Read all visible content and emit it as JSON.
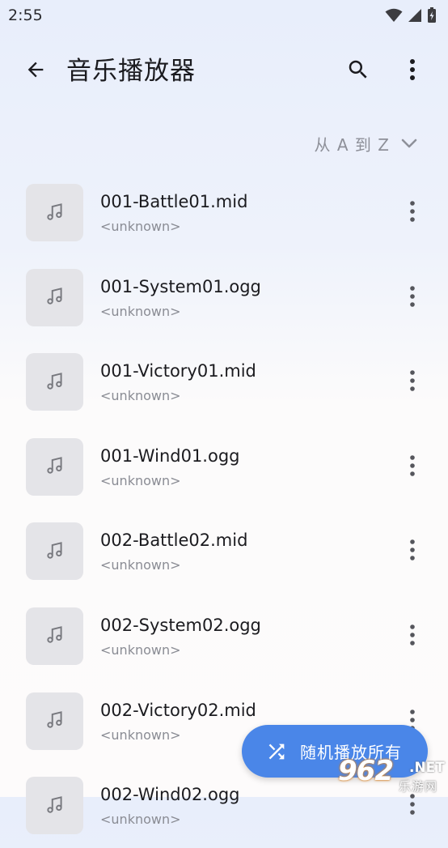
{
  "status_bar": {
    "time": "2:55"
  },
  "app_bar": {
    "title": "音乐播放器"
  },
  "sort": {
    "label": "从 A 到 Z"
  },
  "songs": [
    {
      "title": "001-Battle01.mid",
      "artist": "<unknown>"
    },
    {
      "title": "001-System01.ogg",
      "artist": "<unknown>"
    },
    {
      "title": "001-Victory01.mid",
      "artist": "<unknown>"
    },
    {
      "title": "001-Wind01.ogg",
      "artist": "<unknown>"
    },
    {
      "title": "002-Battle02.mid",
      "artist": "<unknown>"
    },
    {
      "title": "002-System02.ogg",
      "artist": "<unknown>"
    },
    {
      "title": "002-Victory02.mid",
      "artist": "<unknown>"
    },
    {
      "title": "002-Wind02.ogg",
      "artist": "<unknown>"
    }
  ],
  "fab": {
    "label": "随机播放所有"
  },
  "watermark": {
    "main": "962",
    "net": ".NET",
    "sub": "乐游网"
  },
  "colors": {
    "accent": "#4a86e8",
    "art_bg": "#e4e4e8",
    "secondary_text": "#8a8c94"
  },
  "icons": {
    "back": "arrow-left-icon",
    "search": "search-icon",
    "more": "more-vert-icon",
    "sort": "chevron-down-icon",
    "song": "music-note-icon",
    "fab": "shuffle-icon"
  }
}
